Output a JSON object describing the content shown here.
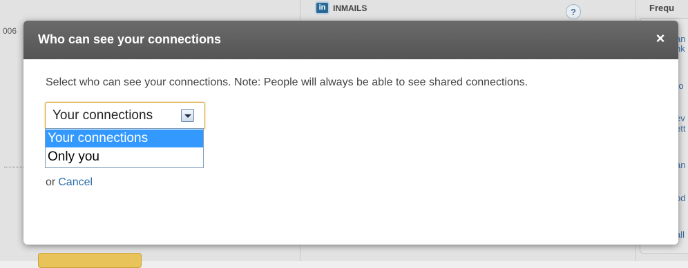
{
  "background": {
    "left_fragment": "006",
    "inmails_logo": "in",
    "inmails_label": "INMAILS",
    "help_icon": "?",
    "right_header": "Frequ",
    "right_links": [
      "an",
      "nk",
      "ro",
      "ev",
      "ett",
      "an",
      "od",
      "all"
    ]
  },
  "modal": {
    "title": "Who can see your connections",
    "close_symbol": "×",
    "note": "Select who can see your connections. Note: People will always be able to see shared connections.",
    "select": {
      "value": "Your connections",
      "options": [
        "Your connections",
        "Only you"
      ],
      "highlighted_index": 0
    },
    "cancel_prefix": "or",
    "cancel_label": "Cancel"
  },
  "colors": {
    "header_bg": "#5e5e5e",
    "option_highlight": "#3399ff",
    "link": "#2c6dab",
    "select_focus_border": "#d7a335"
  },
  "icons": {
    "close": "close-icon",
    "dropdown_arrow": "chevron-down-icon",
    "help": "help-icon",
    "linkedin": "linkedin-icon"
  }
}
